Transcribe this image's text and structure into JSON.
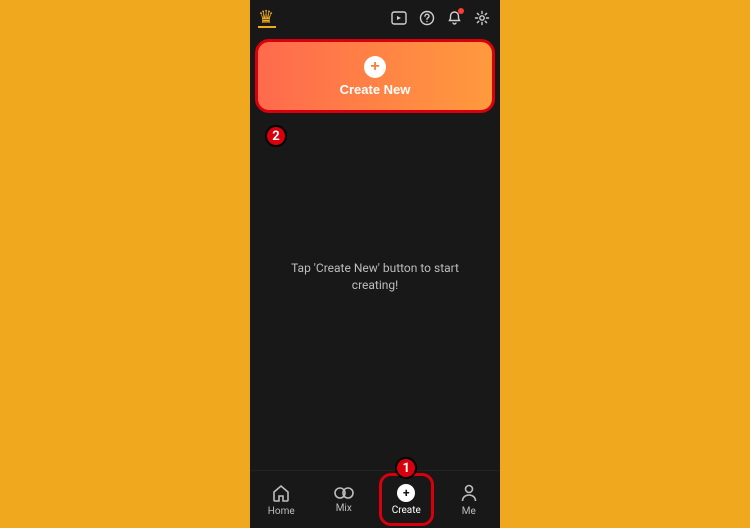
{
  "create_button": {
    "label": "Create New"
  },
  "empty_message": "Tap 'Create New' button to start creating!",
  "annotations": {
    "step1": "1",
    "step2": "2"
  },
  "nav": {
    "home": "Home",
    "mix": "Mix",
    "create": "Create",
    "me": "Me"
  }
}
